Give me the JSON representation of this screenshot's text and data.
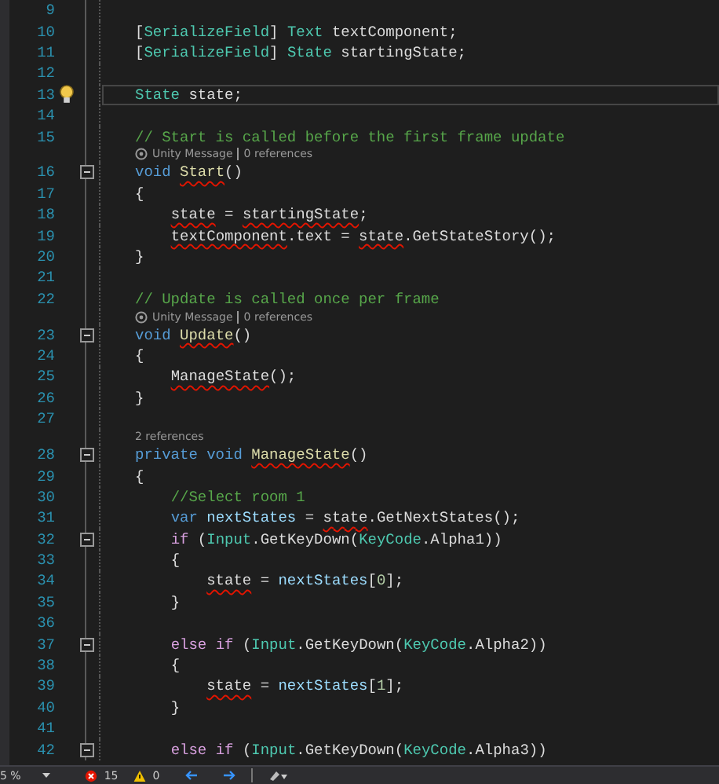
{
  "editor": {
    "lines": [
      {
        "kind": "code",
        "number": "9"
      },
      {
        "kind": "code",
        "number": "10",
        "tokens": [
          {
            "t": "[",
            "kind": "plain"
          },
          {
            "t": "SerializeField",
            "kind": "type"
          },
          {
            "t": "]",
            "kind": "plain"
          },
          {
            "t": " Text",
            "kind": "type"
          },
          {
            "t": " textComponent;",
            "kind": "plain"
          }
        ]
      },
      {
        "kind": "code",
        "number": "11",
        "tokens": [
          {
            "t": "[",
            "kind": "plain"
          },
          {
            "t": "SerializeField",
            "kind": "type"
          },
          {
            "t": "]",
            "kind": "plain"
          },
          {
            "t": " State",
            "kind": "type"
          },
          {
            "t": " startingState;",
            "kind": "plain"
          }
        ]
      },
      {
        "kind": "code",
        "number": "12"
      },
      {
        "kind": "code",
        "number": "13",
        "current": true,
        "lightbulb": true,
        "tokens": [
          {
            "t": "State",
            "kind": "type"
          },
          {
            "t": " state;",
            "kind": "plain"
          }
        ]
      },
      {
        "kind": "code",
        "number": "14"
      },
      {
        "kind": "code",
        "number": "15",
        "tokens": [
          {
            "t": "// Start is called before the first frame update",
            "kind": "comment"
          }
        ]
      },
      {
        "kind": "lens",
        "parts": [
          "Unity Message",
          "0 references"
        ],
        "unity": true
      },
      {
        "kind": "code",
        "number": "16",
        "fold": true,
        "tokens": [
          {
            "t": "void ",
            "kind": "keyword"
          },
          {
            "t": "Start",
            "kind": "method",
            "sq": true
          },
          {
            "t": "()",
            "kind": "plain"
          }
        ]
      },
      {
        "kind": "code",
        "number": "17",
        "tokens": [
          {
            "t": "{",
            "kind": "plain"
          }
        ]
      },
      {
        "kind": "code",
        "number": "18",
        "tokens": [
          {
            "t": "    state",
            "kind": "plain",
            "sq": true
          },
          {
            "t": " = ",
            "kind": "plain"
          },
          {
            "t": "startingState",
            "kind": "plain",
            "sq": true
          },
          {
            "t": ";",
            "kind": "plain"
          }
        ]
      },
      {
        "kind": "code",
        "number": "19",
        "tokens": [
          {
            "t": "    textComponent",
            "kind": "plain",
            "sq": true
          },
          {
            "t": ".text = ",
            "kind": "plain"
          },
          {
            "t": "state",
            "kind": "plain",
            "sq": true
          },
          {
            "t": ".GetStateStory();",
            "kind": "plain"
          }
        ]
      },
      {
        "kind": "code",
        "number": "20",
        "tokens": [
          {
            "t": "}",
            "kind": "plain"
          }
        ]
      },
      {
        "kind": "code",
        "number": "21"
      },
      {
        "kind": "code",
        "number": "22",
        "tokens": [
          {
            "t": "// Update is called once per frame",
            "kind": "comment"
          }
        ]
      },
      {
        "kind": "lens",
        "parts": [
          "Unity Message",
          "0 references"
        ],
        "unity": true
      },
      {
        "kind": "code",
        "number": "23",
        "fold": true,
        "tokens": [
          {
            "t": "void ",
            "kind": "keyword"
          },
          {
            "t": "Update",
            "kind": "method",
            "sq": true
          },
          {
            "t": "()",
            "kind": "plain"
          }
        ]
      },
      {
        "kind": "code",
        "number": "24",
        "tokens": [
          {
            "t": "{",
            "kind": "plain"
          }
        ]
      },
      {
        "kind": "code",
        "number": "25",
        "tokens": [
          {
            "t": "    ManageState",
            "kind": "plain",
            "sq": true
          },
          {
            "t": "();",
            "kind": "plain"
          }
        ]
      },
      {
        "kind": "code",
        "number": "26",
        "tokens": [
          {
            "t": "}",
            "kind": "plain"
          }
        ]
      },
      {
        "kind": "code",
        "number": "27"
      },
      {
        "kind": "lens",
        "parts": [
          "2 references"
        ],
        "unity": false
      },
      {
        "kind": "code",
        "number": "28",
        "fold": true,
        "tokens": [
          {
            "t": "private void ",
            "kind": "keyword"
          },
          {
            "t": "ManageState",
            "kind": "method",
            "sq": true
          },
          {
            "t": "()",
            "kind": "plain"
          }
        ]
      },
      {
        "kind": "code",
        "number": "29",
        "tokens": [
          {
            "t": "{",
            "kind": "plain"
          }
        ]
      },
      {
        "kind": "code",
        "number": "30",
        "tokens": [
          {
            "t": "    //Select room 1",
            "kind": "comment"
          }
        ]
      },
      {
        "kind": "code",
        "number": "31",
        "tokens": [
          {
            "t": "    var",
            "kind": "keyword"
          },
          {
            "t": " nextStates",
            "kind": "variable"
          },
          {
            "t": " = ",
            "kind": "plain"
          },
          {
            "t": "state",
            "kind": "plain",
            "sq": true
          },
          {
            "t": ".GetNextStates();",
            "kind": "plain"
          }
        ]
      },
      {
        "kind": "code",
        "number": "32",
        "fold": true,
        "tokens": [
          {
            "t": "    if",
            "kind": "control"
          },
          {
            "t": " (",
            "kind": "plain"
          },
          {
            "t": "Input",
            "kind": "type"
          },
          {
            "t": ".GetKeyDown(",
            "kind": "plain"
          },
          {
            "t": "KeyCode",
            "kind": "type"
          },
          {
            "t": ".Alpha1))",
            "kind": "plain"
          }
        ]
      },
      {
        "kind": "code",
        "number": "33",
        "tokens": [
          {
            "t": "    {",
            "kind": "plain"
          }
        ]
      },
      {
        "kind": "code",
        "number": "34",
        "tokens": [
          {
            "t": "        state",
            "kind": "plain",
            "sq": true
          },
          {
            "t": " = ",
            "kind": "plain"
          },
          {
            "t": "nextStates",
            "kind": "variable"
          },
          {
            "t": "[",
            "kind": "plain"
          },
          {
            "t": "0",
            "kind": "number"
          },
          {
            "t": "];",
            "kind": "plain"
          }
        ]
      },
      {
        "kind": "code",
        "number": "35",
        "tokens": [
          {
            "t": "    }",
            "kind": "plain"
          }
        ]
      },
      {
        "kind": "code",
        "number": "36"
      },
      {
        "kind": "code",
        "number": "37",
        "fold": true,
        "tokens": [
          {
            "t": "    else if",
            "kind": "control"
          },
          {
            "t": " (",
            "kind": "plain"
          },
          {
            "t": "Input",
            "kind": "type"
          },
          {
            "t": ".GetKeyDown(",
            "kind": "plain"
          },
          {
            "t": "KeyCode",
            "kind": "type"
          },
          {
            "t": ".Alpha2))",
            "kind": "plain"
          }
        ]
      },
      {
        "kind": "code",
        "number": "38",
        "tokens": [
          {
            "t": "    {",
            "kind": "plain"
          }
        ]
      },
      {
        "kind": "code",
        "number": "39",
        "tokens": [
          {
            "t": "        state",
            "kind": "plain",
            "sq": true
          },
          {
            "t": " = ",
            "kind": "plain"
          },
          {
            "t": "nextStates",
            "kind": "variable"
          },
          {
            "t": "[",
            "kind": "plain"
          },
          {
            "t": "1",
            "kind": "number"
          },
          {
            "t": "];",
            "kind": "plain"
          }
        ]
      },
      {
        "kind": "code",
        "number": "40",
        "tokens": [
          {
            "t": "    }",
            "kind": "plain"
          }
        ]
      },
      {
        "kind": "code",
        "number": "41"
      },
      {
        "kind": "code",
        "number": "42",
        "fold": true,
        "tokens": [
          {
            "t": "    else if",
            "kind": "control"
          },
          {
            "t": " (",
            "kind": "plain"
          },
          {
            "t": "Input",
            "kind": "type"
          },
          {
            "t": ".GetKeyDown(",
            "kind": "plain"
          },
          {
            "t": "KeyCode",
            "kind": "type"
          },
          {
            "t": ".Alpha3))",
            "kind": "plain"
          }
        ]
      }
    ]
  },
  "status_bar": {
    "zoom": "5 %",
    "errors": "15",
    "warnings": "0"
  }
}
